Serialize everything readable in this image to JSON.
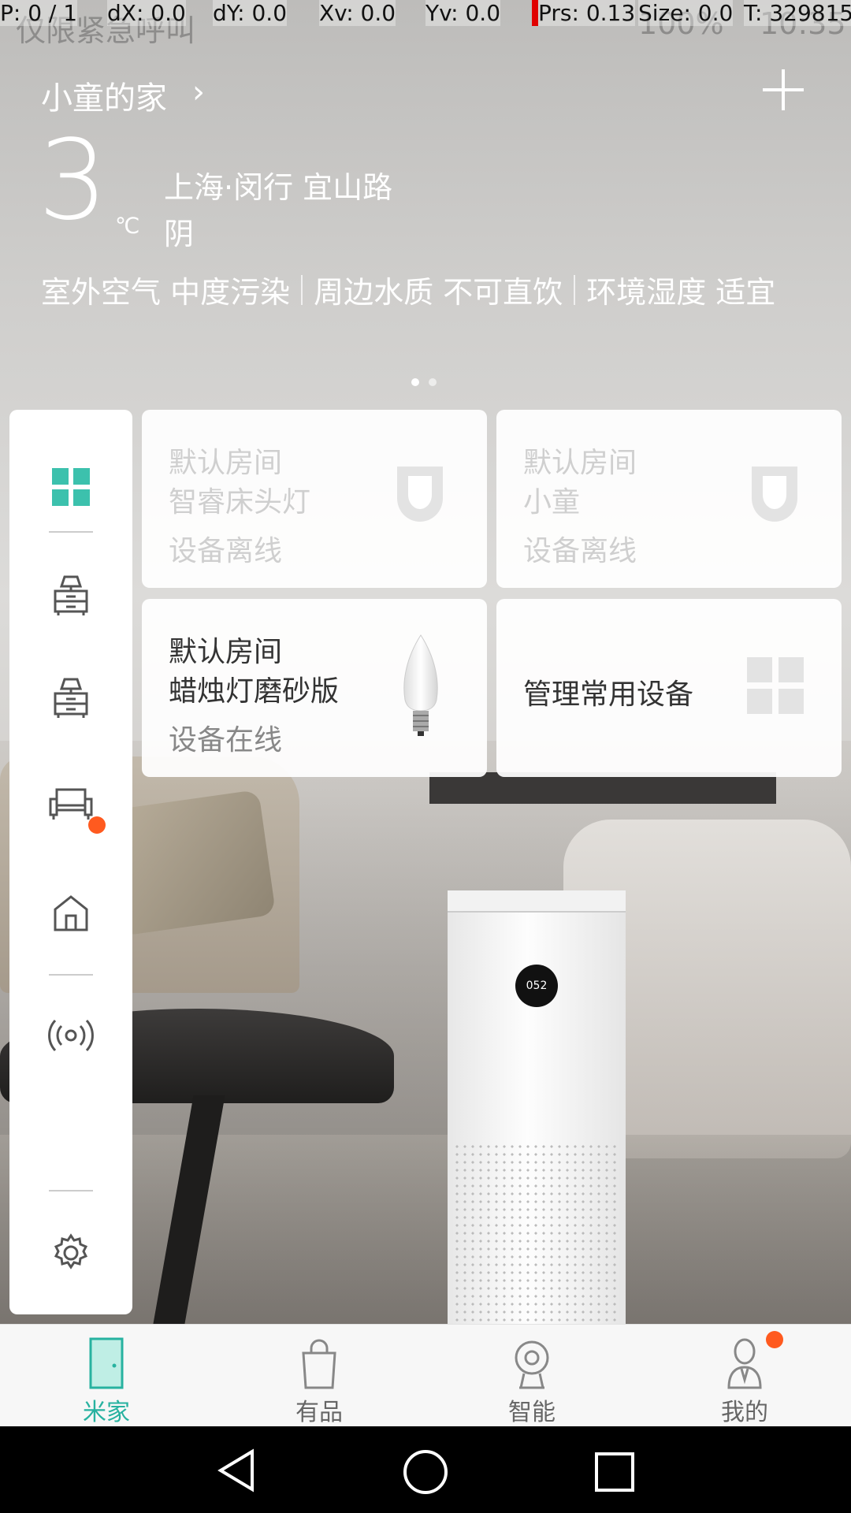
{
  "status_bar": {
    "debug": {
      "p": "P: 0 / 1",
      "dx": "dX: 0.0",
      "dy": "dY: 0.0",
      "xv": "Xv: 0.0",
      "yv": "Yv: 0.0",
      "prs": "Prs: 0.13",
      "size": "Size: 0.0",
      "t": "T: 329815"
    },
    "carrier": "仅限紧急呼叫",
    "battery": "100%",
    "time": "10:35"
  },
  "header": {
    "home_name": "小童的家",
    "temperature": "3",
    "unit": "℃",
    "location": "上海·闵行 宜山路",
    "weather": "阴",
    "env": [
      "室外空气 中度污染",
      "周边水质 不可直饮",
      "环境湿度 适宜"
    ]
  },
  "pager": {
    "count": 2,
    "active": 0
  },
  "rail": {
    "items": [
      "grid-icon",
      "room-icon",
      "room-icon",
      "sofa-icon",
      "house-icon",
      "signal-icon",
      "gear-icon"
    ],
    "signal_has_badge": true
  },
  "cards": [
    {
      "room": "默认房间",
      "name": "智睿床头灯",
      "status": "设备离线"
    },
    {
      "room": "默认房间",
      "name": "小童",
      "status": "设备离线"
    },
    {
      "room": "默认房间",
      "name": "蜡烛灯磨砂版",
      "status": "设备在线"
    },
    {
      "label": "管理常用设备"
    }
  ],
  "purifier_display": "052",
  "bottom_nav": {
    "items": [
      {
        "label": "米家",
        "icon": "door-icon",
        "active": true
      },
      {
        "label": "有品",
        "icon": "bag-icon",
        "active": false
      },
      {
        "label": "智能",
        "icon": "camera-icon",
        "active": false
      },
      {
        "label": "我的",
        "icon": "person-icon",
        "active": false,
        "badge": true
      }
    ]
  },
  "colors": {
    "accent": "#27b2a0",
    "badge": "#ff5a1f"
  }
}
